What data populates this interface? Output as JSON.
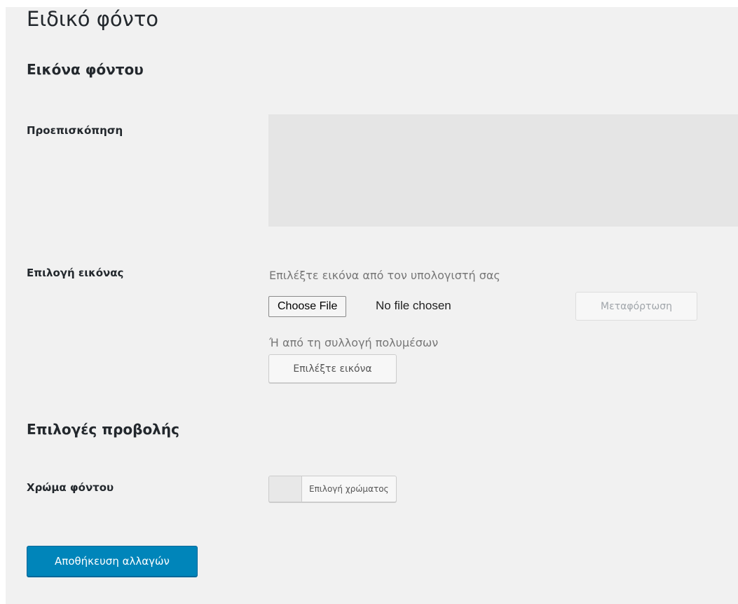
{
  "header": {
    "title": "Ειδικό φόντο"
  },
  "background_image": {
    "section_title": "Εικόνα φόντου",
    "preview_label": "Προεπισκόπηση",
    "select_label": "Επιλογή εικόνας",
    "computer_hint": "Επιλέξτε εικόνα από τον υπολογιστή σας",
    "file_button_label": "Choose File",
    "file_status": "No file chosen",
    "upload_button_label": "Μεταφόρτωση",
    "library_hint": "Ή από τη συλλογή πολυμέσων",
    "choose_image_button_label": "Επιλέξτε εικόνα"
  },
  "display_options": {
    "section_title": "Επιλογές προβολής",
    "color_label": "Χρώμα φόντου",
    "color_picker_label": "Επιλογή χρώματος"
  },
  "footer": {
    "save_button_label": "Αποθήκευση αλλαγών"
  },
  "colors": {
    "page_background": "#f1f1f1",
    "preview_background": "#e5e5e5",
    "primary_button": "#0085ba"
  }
}
